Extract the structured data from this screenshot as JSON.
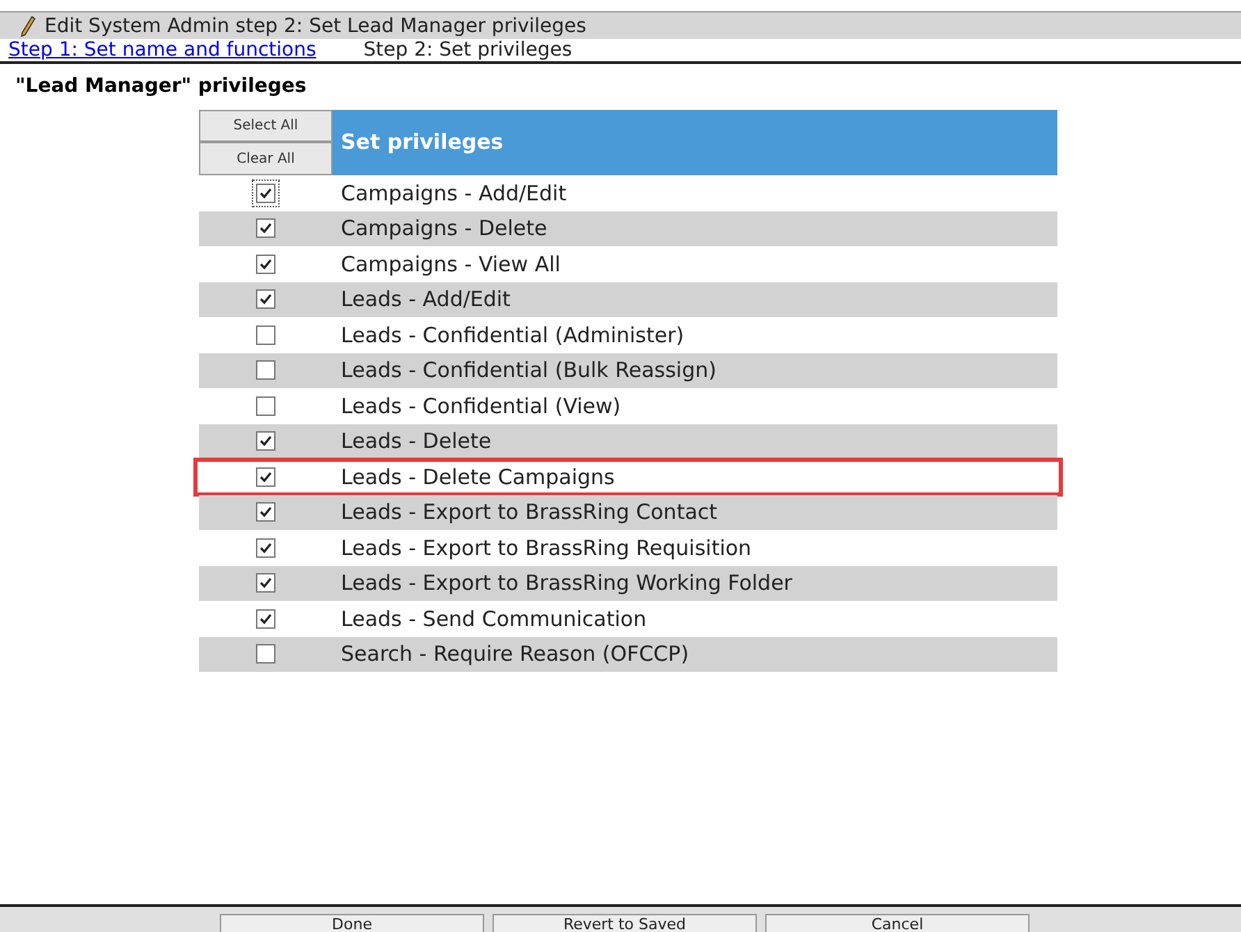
{
  "window": {
    "title": "Edit System Admin step 2: Set Lead Manager privileges"
  },
  "steps": [
    {
      "label": "Step 1: Set name and functions",
      "selected": false
    },
    {
      "label": "Step 2: Set privileges",
      "selected": true
    }
  ],
  "heading": "\"Lead Manager\" privileges",
  "table": {
    "select_all": "Select All",
    "clear_all": "Clear All",
    "header": "Set privileges",
    "rows": [
      {
        "label": "Campaigns - Add/Edit",
        "checked": true,
        "focused": true,
        "highlighted": false
      },
      {
        "label": "Campaigns - Delete",
        "checked": true,
        "focused": false,
        "highlighted": false
      },
      {
        "label": "Campaigns - View All",
        "checked": true,
        "focused": false,
        "highlighted": false
      },
      {
        "label": "Leads - Add/Edit",
        "checked": true,
        "focused": false,
        "highlighted": false
      },
      {
        "label": "Leads - Confidential (Administer)",
        "checked": false,
        "focused": false,
        "highlighted": false
      },
      {
        "label": "Leads - Confidential (Bulk Reassign)",
        "checked": false,
        "focused": false,
        "highlighted": false
      },
      {
        "label": "Leads - Confidential (View)",
        "checked": false,
        "focused": false,
        "highlighted": false
      },
      {
        "label": "Leads - Delete",
        "checked": true,
        "focused": false,
        "highlighted": false
      },
      {
        "label": "Leads - Delete Campaigns",
        "checked": true,
        "focused": false,
        "highlighted": true
      },
      {
        "label": "Leads - Export to BrassRing Contact",
        "checked": true,
        "focused": false,
        "highlighted": false
      },
      {
        "label": "Leads - Export to BrassRing Requisition",
        "checked": true,
        "focused": false,
        "highlighted": false
      },
      {
        "label": "Leads - Export to BrassRing Working Folder",
        "checked": true,
        "focused": false,
        "highlighted": false
      },
      {
        "label": "Leads - Send Communication",
        "checked": true,
        "focused": false,
        "highlighted": false
      },
      {
        "label": "Search - Require Reason (OFCCP)",
        "checked": false,
        "focused": false,
        "highlighted": false
      }
    ]
  },
  "buttons": [
    "Done",
    "Revert to Saved",
    "Cancel"
  ]
}
